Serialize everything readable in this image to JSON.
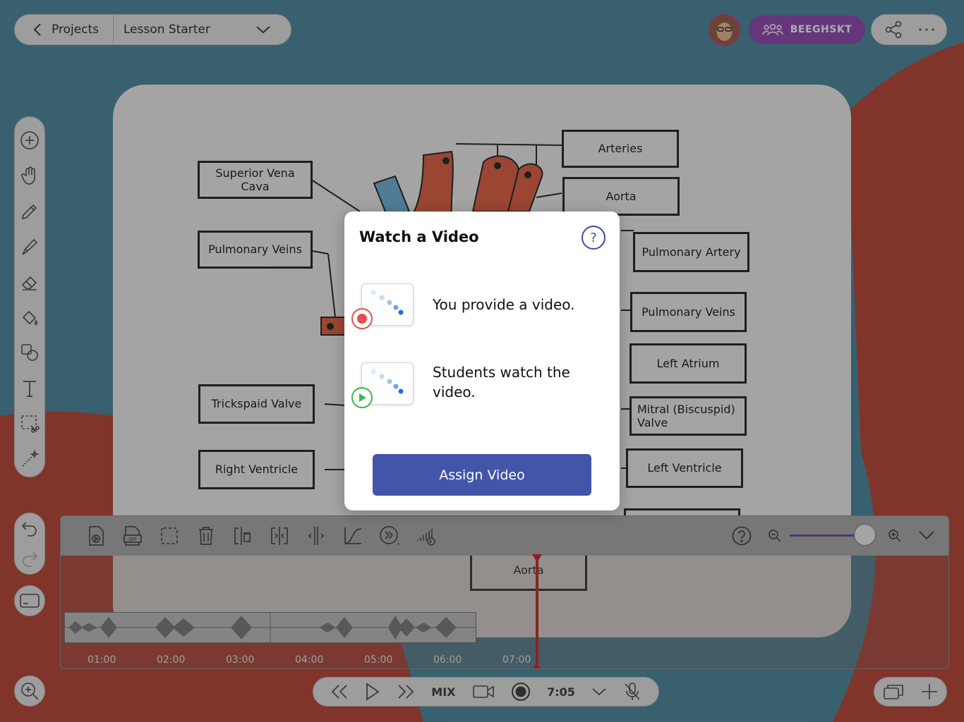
{
  "topbar": {
    "back_label": "Projects",
    "lesson_label": "Lesson Starter",
    "class_label": "BEEGHSKT"
  },
  "diagram": {
    "labels_left": [
      "Superior Vena Cava",
      "Pulmonary Veins",
      "Trickspaid Valve",
      "Right Ventricle"
    ],
    "labels_right": [
      "Arteries",
      "Aorta",
      "Pulmonary Artery",
      "Pulmonary Veins",
      "Left Atrium",
      "Mitral (Biscuspid) Valve",
      "Left Ventricle"
    ],
    "bottom_label": "Aorta"
  },
  "modal": {
    "title": "Watch a Video",
    "help_symbol": "?",
    "step1": "You provide a video.",
    "step2": "Students watch the video.",
    "assign_label": "Assign Video"
  },
  "timeline": {
    "ticks": [
      "01:00",
      "02:00",
      "03:00",
      "04:00",
      "05:00",
      "06:00",
      "07:00"
    ],
    "zoom_level": 0.8
  },
  "playback": {
    "mix_label": "MIX",
    "time": "7:05"
  },
  "colors": {
    "background": "#43849c",
    "blob": "#b83c2a",
    "accent": "#4355a9",
    "class_button": "#8c3fae",
    "playhead": "#c8201e",
    "record": "#e84c4c",
    "play": "#3bb54a"
  },
  "icons": {
    "left_toolbar": [
      "add-icon",
      "hand-icon",
      "pencil-icon",
      "marker-icon",
      "eraser-icon",
      "fill-icon",
      "shapes-icon",
      "text-icon",
      "select-cut-icon",
      "magic-wand-icon"
    ],
    "timeline_toolbar": [
      "video-file-icon",
      "gif-icon",
      "select-icon",
      "trash-icon",
      "split-delete-icon",
      "split-icon",
      "split-expand-icon",
      "curve-icon",
      "speed-icon",
      "volume-fade-icon"
    ]
  }
}
